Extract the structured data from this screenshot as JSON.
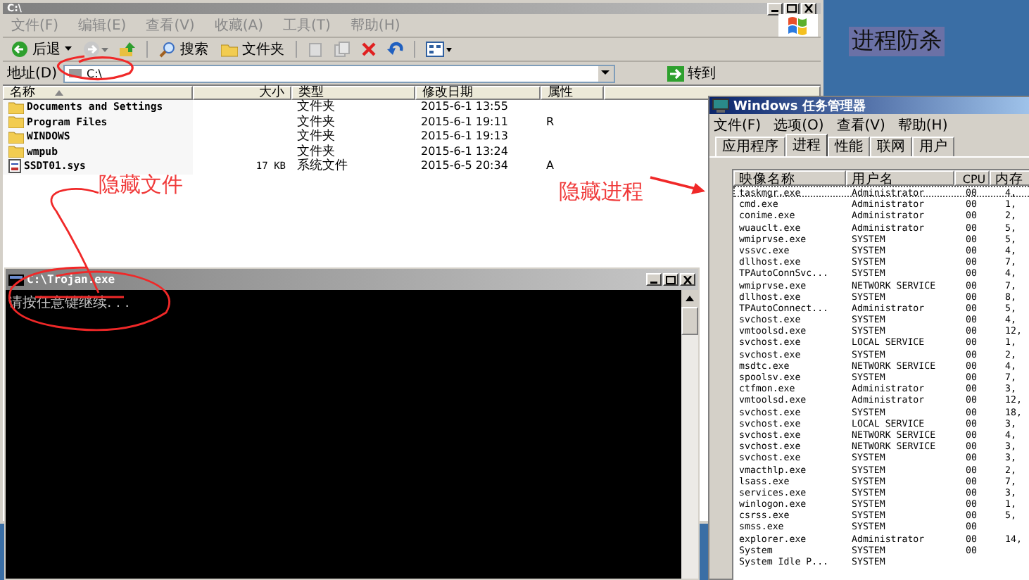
{
  "explorer": {
    "title": "C:\\",
    "menu": [
      "文件(F)",
      "编辑(E)",
      "查看(V)",
      "收藏(A)",
      "工具(T)",
      "帮助(H)"
    ],
    "toolbar": {
      "back": "后退",
      "search": "搜索",
      "folders": "文件夹"
    },
    "address": {
      "label": "地址(D)",
      "value": "C:\\",
      "go": "转到"
    },
    "columns": [
      "名称",
      "大小",
      "类型",
      "修改日期",
      "属性"
    ],
    "rows": [
      {
        "kind": "folder",
        "name": "Documents and Settings",
        "size": "",
        "type": "文件夹",
        "modified": "2015-6-1 13:55",
        "attr": ""
      },
      {
        "kind": "folder",
        "name": "Program Files",
        "size": "",
        "type": "文件夹",
        "modified": "2015-6-1 19:11",
        "attr": "R"
      },
      {
        "kind": "folder",
        "name": "WINDOWS",
        "size": "",
        "type": "文件夹",
        "modified": "2015-6-1 19:13",
        "attr": ""
      },
      {
        "kind": "folder",
        "name": "wmpub",
        "size": "",
        "type": "文件夹",
        "modified": "2015-6-1 13:24",
        "attr": ""
      },
      {
        "kind": "file",
        "name": "SSDT01.sys",
        "size": "17 KB",
        "type": "系统文件",
        "modified": "2015-6-5 20:34",
        "attr": "A"
      }
    ]
  },
  "desktop_label": "进程防杀",
  "console": {
    "title": "C:\\Trojan.exe",
    "text": "请按任意键继续. . ."
  },
  "task_manager": {
    "title": "Windows 任务管理器",
    "menu": [
      "文件(F)",
      "选项(O)",
      "查看(V)",
      "帮助(H)"
    ],
    "tabs": [
      {
        "label": "应用程序",
        "selected": false
      },
      {
        "label": "进程",
        "selected": true
      },
      {
        "label": "性能",
        "selected": false
      },
      {
        "label": "联网",
        "selected": false
      },
      {
        "label": "用户",
        "selected": false
      }
    ],
    "columns": [
      "映像名称",
      "用户名",
      "CPU",
      "内存"
    ],
    "rows": [
      {
        "name": "taskmgr.exe",
        "user": "Administrator",
        "cpu": "00",
        "mem": "4,",
        "selected": true
      },
      {
        "name": "cmd.exe",
        "user": "Administrator",
        "cpu": "00",
        "mem": "1,",
        "selected": false
      },
      {
        "name": "conime.exe",
        "user": "Administrator",
        "cpu": "00",
        "mem": "2,",
        "selected": false
      },
      {
        "name": "wuauclt.exe",
        "user": "Administrator",
        "cpu": "00",
        "mem": "5,",
        "selected": false
      },
      {
        "name": "wmiprvse.exe",
        "user": "SYSTEM",
        "cpu": "00",
        "mem": "5,",
        "selected": false
      },
      {
        "name": "vssvc.exe",
        "user": "SYSTEM",
        "cpu": "00",
        "mem": "4,",
        "selected": false
      },
      {
        "name": "dllhost.exe",
        "user": "SYSTEM",
        "cpu": "00",
        "mem": "7,",
        "selected": false
      },
      {
        "name": "TPAutoConnSvc...",
        "user": "SYSTEM",
        "cpu": "00",
        "mem": "4,",
        "selected": false
      },
      {
        "name": "wmiprvse.exe",
        "user": "NETWORK SERVICE",
        "cpu": "00",
        "mem": "7,",
        "selected": false
      },
      {
        "name": "dllhost.exe",
        "user": "SYSTEM",
        "cpu": "00",
        "mem": "8,",
        "selected": false
      },
      {
        "name": "TPAutoConnect...",
        "user": "Administrator",
        "cpu": "00",
        "mem": "5,",
        "selected": false
      },
      {
        "name": "svchost.exe",
        "user": "SYSTEM",
        "cpu": "00",
        "mem": "4,",
        "selected": false
      },
      {
        "name": "vmtoolsd.exe",
        "user": "SYSTEM",
        "cpu": "00",
        "mem": "12,",
        "selected": false
      },
      {
        "name": "svchost.exe",
        "user": "LOCAL SERVICE",
        "cpu": "00",
        "mem": "1,",
        "selected": false
      },
      {
        "name": "svchost.exe",
        "user": "SYSTEM",
        "cpu": "00",
        "mem": "2,",
        "selected": false
      },
      {
        "name": "msdtc.exe",
        "user": "NETWORK SERVICE",
        "cpu": "00",
        "mem": "4,",
        "selected": false
      },
      {
        "name": "spoolsv.exe",
        "user": "SYSTEM",
        "cpu": "00",
        "mem": "7,",
        "selected": false
      },
      {
        "name": "ctfmon.exe",
        "user": "Administrator",
        "cpu": "00",
        "mem": "3,",
        "selected": false
      },
      {
        "name": "vmtoolsd.exe",
        "user": "Administrator",
        "cpu": "00",
        "mem": "12,",
        "selected": false
      },
      {
        "name": "svchost.exe",
        "user": "SYSTEM",
        "cpu": "00",
        "mem": "18,",
        "selected": false
      },
      {
        "name": "svchost.exe",
        "user": "LOCAL SERVICE",
        "cpu": "00",
        "mem": "3,",
        "selected": false
      },
      {
        "name": "svchost.exe",
        "user": "NETWORK SERVICE",
        "cpu": "00",
        "mem": "4,",
        "selected": false
      },
      {
        "name": "svchost.exe",
        "user": "NETWORK SERVICE",
        "cpu": "00",
        "mem": "3,",
        "selected": false
      },
      {
        "name": "svchost.exe",
        "user": "SYSTEM",
        "cpu": "00",
        "mem": "3,",
        "selected": false
      },
      {
        "name": "vmacthlp.exe",
        "user": "SYSTEM",
        "cpu": "00",
        "mem": "2,",
        "selected": false
      },
      {
        "name": "lsass.exe",
        "user": "SYSTEM",
        "cpu": "00",
        "mem": "7,",
        "selected": false
      },
      {
        "name": "services.exe",
        "user": "SYSTEM",
        "cpu": "00",
        "mem": "3,",
        "selected": false
      },
      {
        "name": "winlogon.exe",
        "user": "SYSTEM",
        "cpu": "00",
        "mem": "1,",
        "selected": false
      },
      {
        "name": "csrss.exe",
        "user": "SYSTEM",
        "cpu": "00",
        "mem": "5,",
        "selected": false
      },
      {
        "name": "smss.exe",
        "user": "SYSTEM",
        "cpu": "00",
        "mem": "",
        "selected": false
      },
      {
        "name": "explorer.exe",
        "user": "Administrator",
        "cpu": "00",
        "mem": "14,",
        "selected": false
      },
      {
        "name": "System",
        "user": "SYSTEM",
        "cpu": "00",
        "mem": "",
        "selected": false
      },
      {
        "name": "System Idle P...",
        "user": "SYSTEM",
        "cpu": "",
        "mem": "",
        "selected": false
      }
    ]
  },
  "annotations": [
    {
      "text": "隐藏文件"
    },
    {
      "text": "隐藏进程"
    }
  ]
}
